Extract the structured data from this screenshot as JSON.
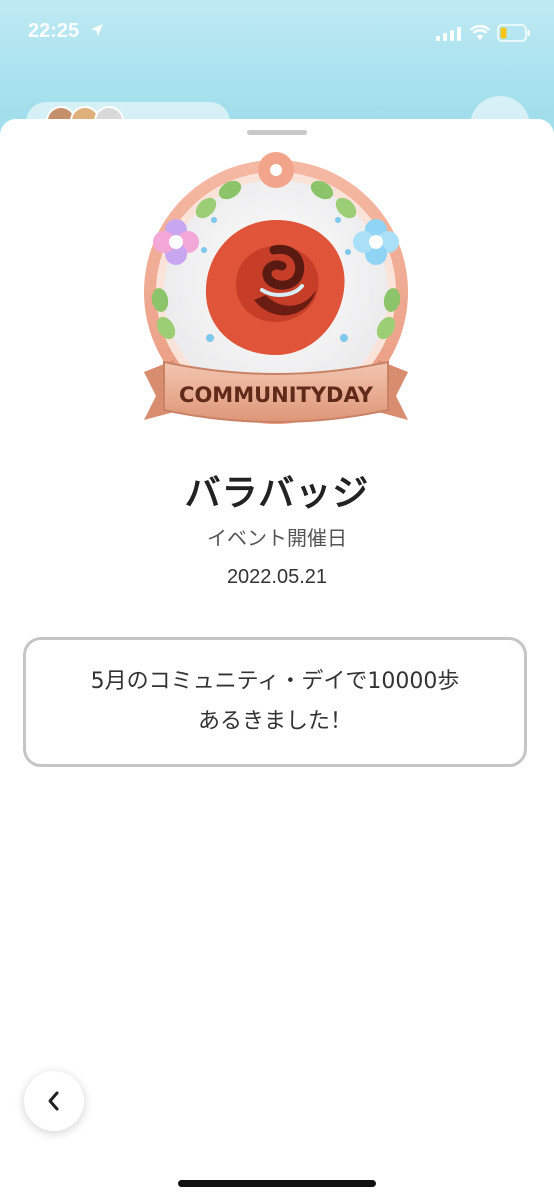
{
  "status_bar": {
    "time": "22:25"
  },
  "badge": {
    "emblem_text": "COMMUNITYDAY",
    "name": "バラバッジ",
    "event_label": "イベント開催日",
    "event_date": "2022.05.21"
  },
  "message": {
    "text": "5月のコミュニティ・デイで10000歩\nあるきました！"
  },
  "colors": {
    "sky_top": "#bfeaf3",
    "sky_bottom": "#9fdbe9",
    "rose": "#e0553a",
    "ribbon": "#e9b49a",
    "box_border": "#c5c5c5"
  },
  "icons": {
    "back": "chevron-left-icon",
    "location": "location-arrow-icon",
    "signal": "signal-icon",
    "wifi": "wifi-icon",
    "battery": "battery-icon"
  }
}
